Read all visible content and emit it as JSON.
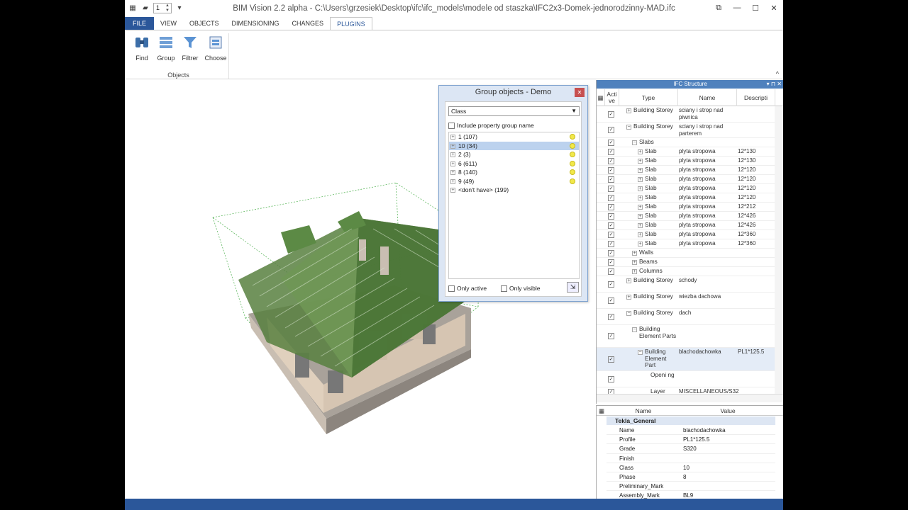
{
  "app": {
    "title": "BIM Vision 2.2 alpha - C:\\Users\\grzesiek\\Desktop\\ifc\\ifc_models\\modele od staszka\\IFC2x3-Domek-jednorodzinny-MAD.ifc",
    "quick_access_value": "1"
  },
  "tabs": [
    {
      "label": "FILE"
    },
    {
      "label": "VIEW"
    },
    {
      "label": "OBJECTS"
    },
    {
      "label": "DIMENSIONING"
    },
    {
      "label": "CHANGES"
    },
    {
      "label": "PLUGINS"
    }
  ],
  "ribbon": {
    "find": "Find",
    "group": "Group",
    "filter": "Filtrer",
    "choose": "Choose",
    "group_label": "Objects"
  },
  "dialog": {
    "title": "Group objects - Demo",
    "select_value": "Class",
    "include_label": "Include property group name",
    "items": [
      {
        "label": "1 (107)"
      },
      {
        "label": "10 (34)"
      },
      {
        "label": "2 (3)"
      },
      {
        "label": "6 (611)"
      },
      {
        "label": "8 (140)"
      },
      {
        "label": "9 (49)"
      },
      {
        "label": "<don't have> (199)"
      }
    ],
    "only_active": "Only active",
    "only_visible": "Only visible"
  },
  "ifc": {
    "title": "IFC Structure",
    "col_active": "Acti ve",
    "col_type": "Type",
    "col_name": "Name",
    "col_desc": "Descripti",
    "rows": [
      {
        "type": "Building Storey",
        "name": "sciany i strop nad piwnica",
        "desc": ""
      },
      {
        "type": "Building Storey",
        "name": "sciany i strop nad parterem",
        "desc": ""
      },
      {
        "type": "Slabs",
        "name": "",
        "desc": ""
      },
      {
        "type": "Slab",
        "name": "plyta stropowa",
        "desc": "12*130"
      },
      {
        "type": "Slab",
        "name": "plyta stropowa",
        "desc": "12*130"
      },
      {
        "type": "Slab",
        "name": "plyta stropowa",
        "desc": "12*120"
      },
      {
        "type": "Slab",
        "name": "plyta stropowa",
        "desc": "12*120"
      },
      {
        "type": "Slab",
        "name": "plyta stropowa",
        "desc": "12*120"
      },
      {
        "type": "Slab",
        "name": "plyta stropowa",
        "desc": "12*120"
      },
      {
        "type": "Slab",
        "name": "plyta stropowa",
        "desc": "12*212"
      },
      {
        "type": "Slab",
        "name": "plyta stropowa",
        "desc": "12*426"
      },
      {
        "type": "Slab",
        "name": "plyta stropowa",
        "desc": "12*426"
      },
      {
        "type": "Slab",
        "name": "plyta stropowa",
        "desc": "12*360"
      },
      {
        "type": "Slab",
        "name": "plyta stropowa",
        "desc": "12*360"
      },
      {
        "type": "Walls",
        "name": "",
        "desc": ""
      },
      {
        "type": "Beams",
        "name": "",
        "desc": ""
      },
      {
        "type": "Columns",
        "name": "",
        "desc": ""
      },
      {
        "type": "Building Storey",
        "name": "schody",
        "desc": ""
      },
      {
        "type": "Building Storey",
        "name": "wiezba dachowa",
        "desc": ""
      },
      {
        "type": "Building Storey",
        "name": "dach",
        "desc": ""
      },
      {
        "type": "Building Element Parts",
        "name": "",
        "desc": ""
      },
      {
        "type": "Building Element Part",
        "name": "blachodachowka",
        "desc": "PL1*125.5"
      },
      {
        "type": "Openi ng",
        "name": "",
        "desc": ""
      },
      {
        "type": "Layer",
        "name": "MISCELLANEOUS/S32",
        "desc": ""
      }
    ]
  },
  "props": {
    "col_name": "Name",
    "col_value": "Value",
    "group": "Tekla_General",
    "rows": [
      {
        "name": "Name",
        "value": "blachodachowka"
      },
      {
        "name": "Profile",
        "value": "PL1*125.5"
      },
      {
        "name": "Grade",
        "value": "S320"
      },
      {
        "name": "Finish",
        "value": ""
      },
      {
        "name": "Class",
        "value": "10"
      },
      {
        "name": "Phase",
        "value": "8"
      },
      {
        "name": "Preliminary_Mark",
        "value": ""
      },
      {
        "name": "Assembly_Mark",
        "value": "BL9"
      }
    ]
  },
  "colors": {
    "accent": "#2b579a",
    "roof_green": "#3e7a3e",
    "wall": "#d9c8b4"
  }
}
